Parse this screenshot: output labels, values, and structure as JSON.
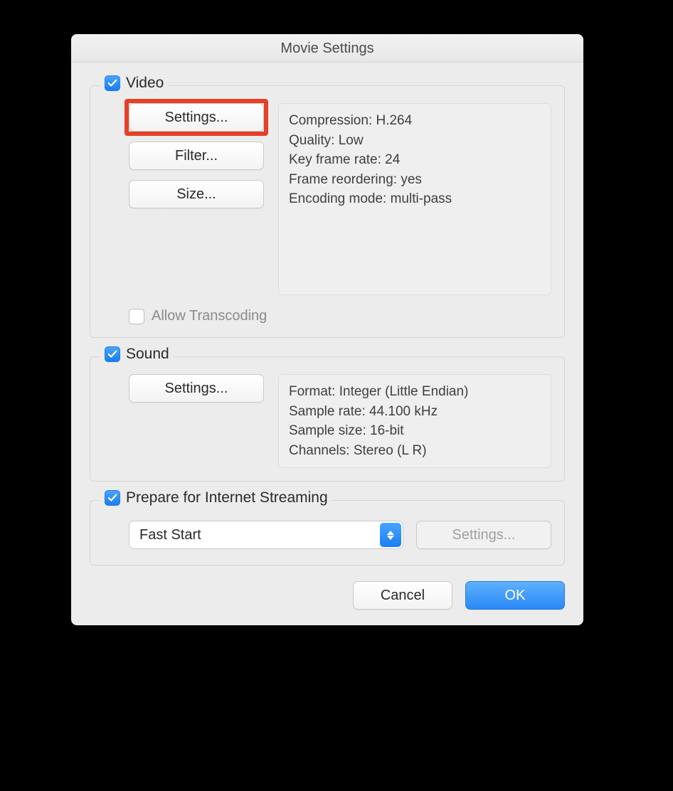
{
  "title": "Movie Settings",
  "video": {
    "label": "Video",
    "checked": true,
    "buttons": {
      "settings": "Settings...",
      "filter": "Filter...",
      "size": "Size..."
    },
    "info": {
      "compression": "Compression: H.264",
      "quality": "Quality: Low",
      "keyframe": "Key frame rate: 24",
      "reorder": "Frame reordering: yes",
      "encoding": "Encoding mode: multi-pass"
    },
    "allow_transcoding": {
      "label": "Allow Transcoding",
      "checked": false
    }
  },
  "sound": {
    "label": "Sound",
    "checked": true,
    "buttons": {
      "settings": "Settings..."
    },
    "info": {
      "format": "Format: Integer (Little Endian)",
      "sample_rate": "Sample rate: 44.100 kHz",
      "sample_size": "Sample size: 16-bit",
      "channels": "Channels: Stereo (L R)"
    }
  },
  "streaming": {
    "label": "Prepare for Internet Streaming",
    "checked": true,
    "select_value": "Fast Start",
    "settings_button": "Settings..."
  },
  "footer": {
    "cancel": "Cancel",
    "ok": "OK"
  }
}
